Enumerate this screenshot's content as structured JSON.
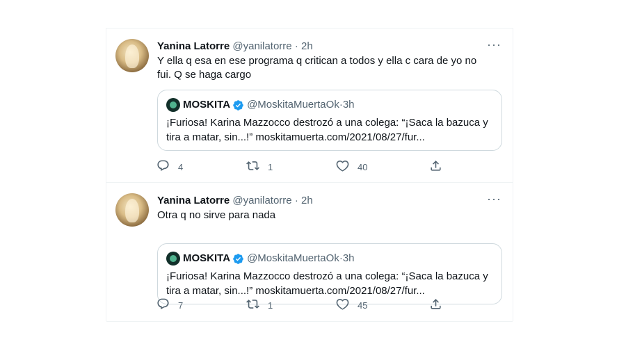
{
  "tweets": [
    {
      "author_name": "Yanina Latorre",
      "author_handle": "@yanilatorre",
      "separator": "·",
      "time": "2h",
      "more_label": "···",
      "text": "Y ella q esa en ese programa q critican a todos y ella c cara de yo no fui. Q se haga cargo",
      "quote": {
        "author_name": "MOSKITA",
        "author_handle": "@MoskitaMuertaOk",
        "separator": "·",
        "time": "3h",
        "text": "¡Furiosa! Karina Mazzocco destrozó a una colega: “¡Saca la bazuca y tira a matar, sin...!” moskitamuerta.com/2021/08/27/fur..."
      },
      "replies": "4",
      "retweets": "1",
      "likes": "40"
    },
    {
      "author_name": "Yanina Latorre",
      "author_handle": "@yanilatorre",
      "separator": "·",
      "time": "2h",
      "more_label": "···",
      "text": "Otra q no sirve para nada",
      "quote": {
        "author_name": "MOSKITA",
        "author_handle": "@MoskitaMuertaOk",
        "separator": "·",
        "time": "3h",
        "text": "¡Furiosa! Karina Mazzocco destrozó a una colega: “¡Saca la bazuca y tira a matar, sin...!” moskitamuerta.com/2021/08/27/fur..."
      },
      "replies": "7",
      "retweets": "1",
      "likes": "45"
    }
  ],
  "icons": {
    "reply": "reply-icon",
    "retweet": "retweet-icon",
    "like": "heart-icon",
    "share": "share-icon",
    "verified": "verified-badge-icon"
  },
  "colors": {
    "text_primary": "#0f1419",
    "text_secondary": "#536471",
    "verified_blue": "#1d9bf0",
    "border": "#cfd9de",
    "divider": "#eff3f4"
  }
}
